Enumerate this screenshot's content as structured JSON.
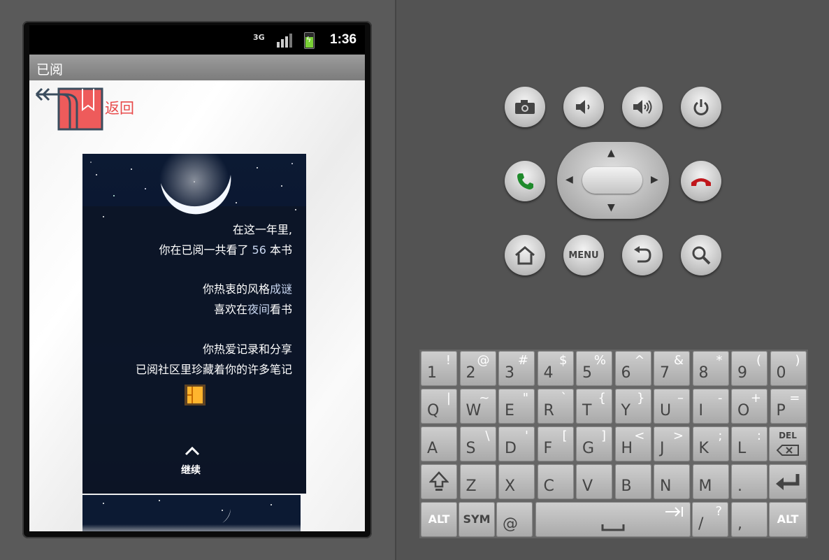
{
  "status_bar": {
    "network": "3G",
    "time": "1:36"
  },
  "app": {
    "title": "已阅",
    "back_label": "返回",
    "card": {
      "line1": "在这一年里,",
      "line2_prefix": "你在已阅一共看了 ",
      "books_count": "56",
      "line2_suffix": " 本书",
      "line3_prefix": "你热衷的风格",
      "style": "成谜",
      "line4_prefix": "喜欢在",
      "time_of_day": "夜间",
      "line4_suffix": "看书",
      "line5": "你热爱记录和分享",
      "line6": "已阅社区里珍藏着你的许多笔记",
      "continue_label": "继续"
    }
  },
  "emulator": {
    "hardware_buttons": {
      "row1": [
        "camera-icon",
        "volume-down-icon",
        "volume-up-icon",
        "power-icon"
      ],
      "row2": [
        "call-icon",
        "end-call-icon"
      ],
      "row3": [
        "home-icon",
        "MENU",
        "back-icon",
        "search-icon"
      ]
    },
    "menu_label": "MENU",
    "keyboard": {
      "row1": [
        {
          "main": "1",
          "alt": "!"
        },
        {
          "main": "2",
          "alt": "@"
        },
        {
          "main": "3",
          "alt": "#"
        },
        {
          "main": "4",
          "alt": "$"
        },
        {
          "main": "5",
          "alt": "%"
        },
        {
          "main": "6",
          "alt": "^"
        },
        {
          "main": "7",
          "alt": "&"
        },
        {
          "main": "8",
          "alt": "*"
        },
        {
          "main": "9",
          "alt": "("
        },
        {
          "main": "0",
          "alt": ")"
        }
      ],
      "row2": [
        {
          "main": "Q",
          "alt": "|"
        },
        {
          "main": "W",
          "alt": "~"
        },
        {
          "main": "E",
          "alt": "\""
        },
        {
          "main": "R",
          "alt": "`"
        },
        {
          "main": "T",
          "alt": "{"
        },
        {
          "main": "Y",
          "alt": "}"
        },
        {
          "main": "U",
          "alt": "–"
        },
        {
          "main": "I",
          "alt": "-"
        },
        {
          "main": "O",
          "alt": "+"
        },
        {
          "main": "P",
          "alt": "="
        }
      ],
      "row3": [
        {
          "main": "A",
          "alt": ""
        },
        {
          "main": "S",
          "alt": "\\"
        },
        {
          "main": "D",
          "alt": "'"
        },
        {
          "main": "F",
          "alt": "["
        },
        {
          "main": "G",
          "alt": "]"
        },
        {
          "main": "H",
          "alt": "<"
        },
        {
          "main": "J",
          "alt": ">"
        },
        {
          "main": "K",
          "alt": ";"
        },
        {
          "main": "L",
          "alt": ":"
        }
      ],
      "del_label": "DEL",
      "row4": [
        "Z",
        "X",
        "C",
        "V",
        "B",
        "N",
        "M",
        "."
      ],
      "alt_label": "ALT",
      "sym_label": "SYM",
      "at_label": "@",
      "slash_main": "/",
      "slash_alt": "?",
      "comma": ","
    }
  }
}
